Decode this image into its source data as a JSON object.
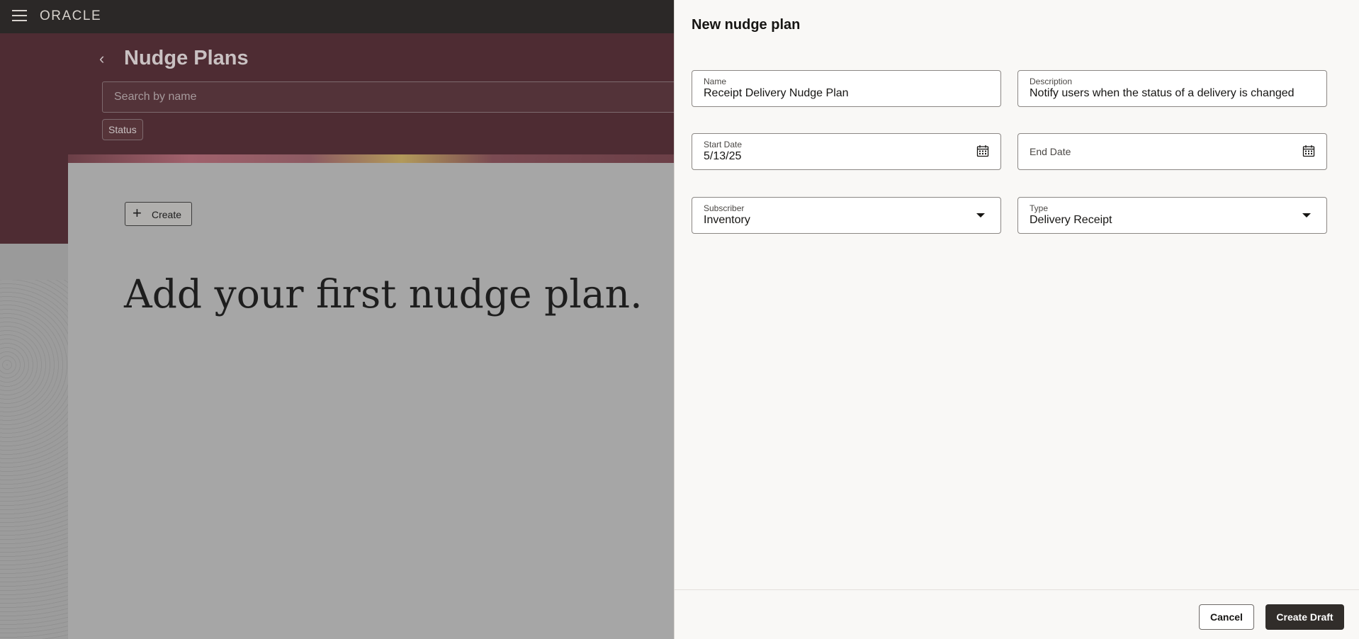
{
  "app": {
    "logo": "ORACLE"
  },
  "page": {
    "title": "Nudge Plans",
    "search_placeholder": "Search by name",
    "status_filter": "Status",
    "create_label": "Create",
    "empty_heading": "Add your first nudge plan."
  },
  "drawer": {
    "title": "New nudge plan",
    "fields": {
      "name": {
        "label": "Name",
        "value": "Receipt Delivery Nudge Plan"
      },
      "description": {
        "label": "Description",
        "value": "Notify users when the status of a delivery is changed"
      },
      "start_date": {
        "label": "Start Date",
        "value": "5/13/25"
      },
      "end_date": {
        "label": "End Date",
        "value": ""
      },
      "subscriber": {
        "label": "Subscriber",
        "value": "Inventory"
      },
      "type": {
        "label": "Type",
        "value": "Delivery Receipt"
      }
    },
    "cancel_label": "Cancel",
    "create_draft_label": "Create Draft"
  },
  "icons": {
    "menu": "hamburger-icon",
    "back": "chevron-left-icon",
    "calendar": "calendar-icon",
    "dropdown": "caret-down-icon",
    "plus": "plus-icon"
  },
  "colors": {
    "topbar": "#2b2827",
    "hero": "#4e2c33",
    "primary_button": "#312d2a",
    "drawer_bg": "#f9f8f6"
  }
}
